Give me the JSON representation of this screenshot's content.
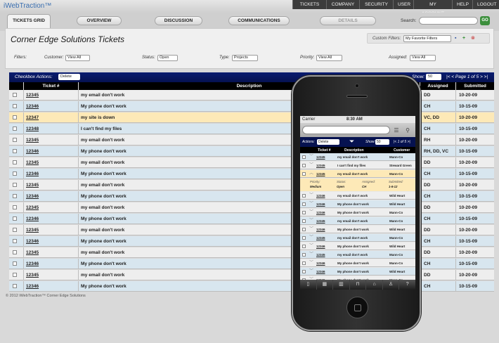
{
  "brand": "iWebTraction™",
  "top_nav": [
    "TICKETS",
    "COMPANY",
    "SECURITY",
    "USER",
    "MY ACCOUNT",
    "HELP",
    "LOGOUT"
  ],
  "tabs": [
    "TICKETS GRID",
    "OVERVIEW",
    "DISCUSSION",
    "COMMUNICATIONS",
    "DETAILS"
  ],
  "search": {
    "label": "Search:",
    "value": "",
    "go_label": "GO"
  },
  "page_title": "Corner Edge Solutions Tickets",
  "custom_filters": {
    "label": "Custom Filters:",
    "value": "My Favorite Filters"
  },
  "filters": {
    "label": "Filters:",
    "customer": {
      "label": "Customer:",
      "value": "View All"
    },
    "status": {
      "label": "Status:",
      "value": "Open"
    },
    "type": {
      "label": "Type:",
      "value": "Projects"
    },
    "priority": {
      "label": "Priority:",
      "value": "View All"
    },
    "assigned": {
      "label": "Assigned:",
      "value": "View All"
    }
  },
  "grid": {
    "checkbox_actions_label": "Checkbox Actions:",
    "checkbox_actions_value": "Delete",
    "show_label": "Show:",
    "show_value": "50",
    "pager": "|< < Page 1 of 5 > >|",
    "headers": {
      "ticket": "Ticket #",
      "description": "Description",
      "assigned": "Assigned",
      "submitted": "Submitted"
    },
    "rows": [
      {
        "ticket": "12345",
        "description": "my email don't work",
        "assigned": "DD",
        "submitted": "10-20-09"
      },
      {
        "ticket": "12346",
        "description": "My phone don't work",
        "assigned": "CH",
        "submitted": "10-15-09"
      },
      {
        "ticket": "12347",
        "description": "my site is down",
        "assigned": "VC, DD",
        "submitted": "10-20-09"
      },
      {
        "ticket": "12348",
        "description": "I can't find my files",
        "assigned": "CH",
        "submitted": "10-15-09"
      },
      {
        "ticket": "12345",
        "description": "my email don't work",
        "assigned": "RH",
        "submitted": "10-20-09"
      },
      {
        "ticket": "12346",
        "description": "My phone don't work",
        "assigned": "RH, DD, VC",
        "submitted": "10-15-09"
      },
      {
        "ticket": "12345",
        "description": "my email don't work",
        "assigned": "DD",
        "submitted": "10-20-09"
      },
      {
        "ticket": "12346",
        "description": "My phone don't work",
        "assigned": "CH",
        "submitted": "10-15-09"
      },
      {
        "ticket": "12345",
        "description": "my email don't work",
        "assigned": "DD",
        "submitted": "10-20-09"
      },
      {
        "ticket": "12346",
        "description": "My phone don't work",
        "assigned": "CH",
        "submitted": "10-15-09"
      },
      {
        "ticket": "12345",
        "description": "my email don't work",
        "assigned": "DD",
        "submitted": "10-20-09"
      },
      {
        "ticket": "12346",
        "description": "My phone don't work",
        "assigned": "CH",
        "submitted": "10-15-09"
      },
      {
        "ticket": "12345",
        "description": "my email don't work",
        "assigned": "DD",
        "submitted": "10-20-09"
      },
      {
        "ticket": "12346",
        "description": "My phone don't work",
        "assigned": "CH",
        "submitted": "10-15-09"
      },
      {
        "ticket": "12345",
        "description": "my email don't work",
        "assigned": "DD",
        "submitted": "10-20-09"
      },
      {
        "ticket": "12346",
        "description": "My phone don't work",
        "assigned": "CH",
        "submitted": "10-15-09"
      },
      {
        "ticket": "12345",
        "description": "my email don't work",
        "assigned": "DD",
        "submitted": "10-20-09"
      },
      {
        "ticket": "12346",
        "description": "My phone don't work",
        "assigned": "CH",
        "submitted": "10-15-09"
      }
    ]
  },
  "footer": "© 2012 iWebTraction™ Corner Edge Solutions",
  "phone": {
    "carrier": "Carrier",
    "time": "8:30 AM",
    "actions_label": "Actions:",
    "actions_value": "Delete",
    "show_label": "Show:",
    "show_value": "50",
    "pager": "|< 1 of 5 >|",
    "headers": {
      "ticket": "Ticket #",
      "description": "Description",
      "customer": "Customer"
    },
    "detail": {
      "priority_label": "Priority:",
      "priority": "Medium",
      "status_label": "Status:",
      "status": "Open",
      "assigned_label": "Assigned:",
      "assigned": "CH",
      "submitted_label": "Submitted:",
      "submitted": "1-6-12"
    },
    "rows": [
      {
        "ticket": "12345",
        "description": "my email don't work",
        "customer": "Mann-Co"
      },
      {
        "ticket": "12345",
        "description": "I can't find my files",
        "customer": "Steward Green"
      },
      {
        "ticket": "12345",
        "description": "my email don't work",
        "customer": "Mann-Co"
      },
      {
        "ticket": "12346",
        "description": "my email don't work",
        "customer": "Wild Heart"
      },
      {
        "ticket": "12346",
        "description": "My phone don't work",
        "customer": "Wild Heart"
      },
      {
        "ticket": "12346",
        "description": "My phone don't work",
        "customer": "Mann-Co"
      },
      {
        "ticket": "12345",
        "description": "my email don't work",
        "customer": "Mann-Co"
      },
      {
        "ticket": "12346",
        "description": "My phone don't work",
        "customer": "Wild Heart"
      },
      {
        "ticket": "12345",
        "description": "my email don't work",
        "customer": "Mann-Co"
      },
      {
        "ticket": "12346",
        "description": "My phone don't work",
        "customer": "Wild Heart"
      },
      {
        "ticket": "12345",
        "description": "my email don't work",
        "customer": "Mann-Co"
      },
      {
        "ticket": "12346",
        "description": "My phone don't work",
        "customer": "Mann-Co"
      },
      {
        "ticket": "12346",
        "description": "My phone don't work",
        "customer": "Wild Heart"
      },
      {
        "ticket": "12346",
        "description": "My phone don't work",
        "customer": "Mann-Co"
      }
    ],
    "tab_icons": [
      "bookmark-icon",
      "grid-icon",
      "building-icon",
      "lock-icon",
      "bag-icon",
      "people-icon",
      "help-icon"
    ]
  }
}
